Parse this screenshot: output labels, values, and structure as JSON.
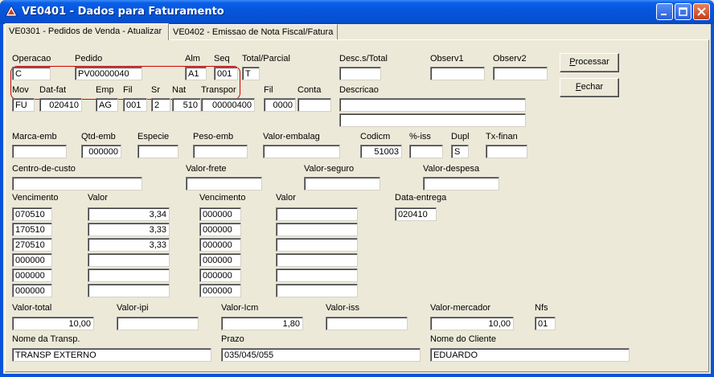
{
  "window": {
    "title": "VE0401 - Dados para Faturamento"
  },
  "tabs": [
    {
      "label": "VE0301   - Pedidos de Venda - Atualizar"
    },
    {
      "label": "VE0402   - Emissao de Nota Fiscal/Fatura"
    }
  ],
  "buttons": {
    "processar_first": "P",
    "processar_rest": "rocessar",
    "fechar_first": "F",
    "fechar_rest": "echar"
  },
  "row1": {
    "operacao": {
      "label": "Operacao",
      "value": "C"
    },
    "pedido": {
      "label": "Pedido",
      "value": "PV00000040"
    },
    "alm": {
      "label": "Alm",
      "value": "A1"
    },
    "seq": {
      "label": "Seq",
      "value": "001"
    },
    "total_parcial": {
      "label": "Total/Parcial",
      "value": "T"
    },
    "desc_total": {
      "label": "Desc.s/Total",
      "value": ""
    },
    "observ1": {
      "label": "Observ1",
      "value": ""
    },
    "observ2": {
      "label": "Observ2",
      "value": ""
    }
  },
  "row2": {
    "mov": {
      "label": "Mov",
      "value": "FU"
    },
    "dat_fat": {
      "label": "Dat-fat",
      "value": "020410"
    },
    "emp": {
      "label": "Emp",
      "value": "AG"
    },
    "fil": {
      "label": "Fil",
      "value": "001"
    },
    "sr": {
      "label": "Sr",
      "value": "2"
    },
    "nat": {
      "label": "Nat",
      "value": "510"
    },
    "transpor": {
      "label": "Transpor",
      "value": "00000400"
    },
    "fil2": {
      "label": "Fil",
      "value": "0000"
    },
    "conta": {
      "label": "Conta",
      "value": ""
    },
    "descricao": {
      "label": "Descricao",
      "value1": "",
      "value2": ""
    }
  },
  "row3": {
    "marca_emb": {
      "label": "Marca-emb",
      "value": ""
    },
    "qtd_emb": {
      "label": "Qtd-emb",
      "value": "000000"
    },
    "especie": {
      "label": "Especie",
      "value": ""
    },
    "peso_emb": {
      "label": "Peso-emb",
      "value": ""
    },
    "valor_embalag": {
      "label": "Valor-embalag",
      "value": ""
    },
    "codicm": {
      "label": "Codicm",
      "value": "51003"
    },
    "pct_iss": {
      "label": "%-iss",
      "value": ""
    },
    "dupl": {
      "label": "Dupl",
      "value": "S"
    },
    "tx_finan": {
      "label": "Tx-finan",
      "value": ""
    }
  },
  "row4": {
    "centro_custo": {
      "label": "Centro-de-custo",
      "value": ""
    },
    "valor_frete": {
      "label": "Valor-frete",
      "value": ""
    },
    "valor_seguro": {
      "label": "Valor-seguro",
      "value": ""
    },
    "valor_despesa": {
      "label": "Valor-despesa",
      "value": ""
    }
  },
  "parcelas": {
    "vencimento_label": "Vencimento",
    "valor_label": "Valor",
    "left": [
      {
        "venc": "070510",
        "valor": "3,34"
      },
      {
        "venc": "170510",
        "valor": "3,33"
      },
      {
        "venc": "270510",
        "valor": "3,33"
      },
      {
        "venc": "000000",
        "valor": ""
      },
      {
        "venc": "000000",
        "valor": ""
      },
      {
        "venc": "000000",
        "valor": ""
      }
    ],
    "right": [
      {
        "venc": "000000",
        "valor": ""
      },
      {
        "venc": "000000",
        "valor": ""
      },
      {
        "venc": "000000",
        "valor": ""
      },
      {
        "venc": "000000",
        "valor": ""
      },
      {
        "venc": "000000",
        "valor": ""
      },
      {
        "venc": "000000",
        "valor": ""
      }
    ],
    "data_entrega": {
      "label": "Data-entrega",
      "value": "020410"
    }
  },
  "totais": {
    "valor_total": {
      "label": "Valor-total",
      "value": "10,00"
    },
    "valor_ipi": {
      "label": "Valor-ipi",
      "value": ""
    },
    "valor_icm": {
      "label": "Valor-Icm",
      "value": "1,80"
    },
    "valor_iss": {
      "label": "Valor-iss",
      "value": ""
    },
    "valor_mercador": {
      "label": "Valor-mercador",
      "value": "10,00"
    },
    "nfs": {
      "label": "Nfs",
      "value": "01"
    }
  },
  "bottom": {
    "nome_transp": {
      "label": "Nome da Transp.",
      "value": "TRANSP EXTERNO"
    },
    "prazo": {
      "label": "Prazo",
      "value": "035/045/055"
    },
    "nome_cliente": {
      "label": "Nome do Cliente",
      "value": "EDUARDO"
    }
  }
}
